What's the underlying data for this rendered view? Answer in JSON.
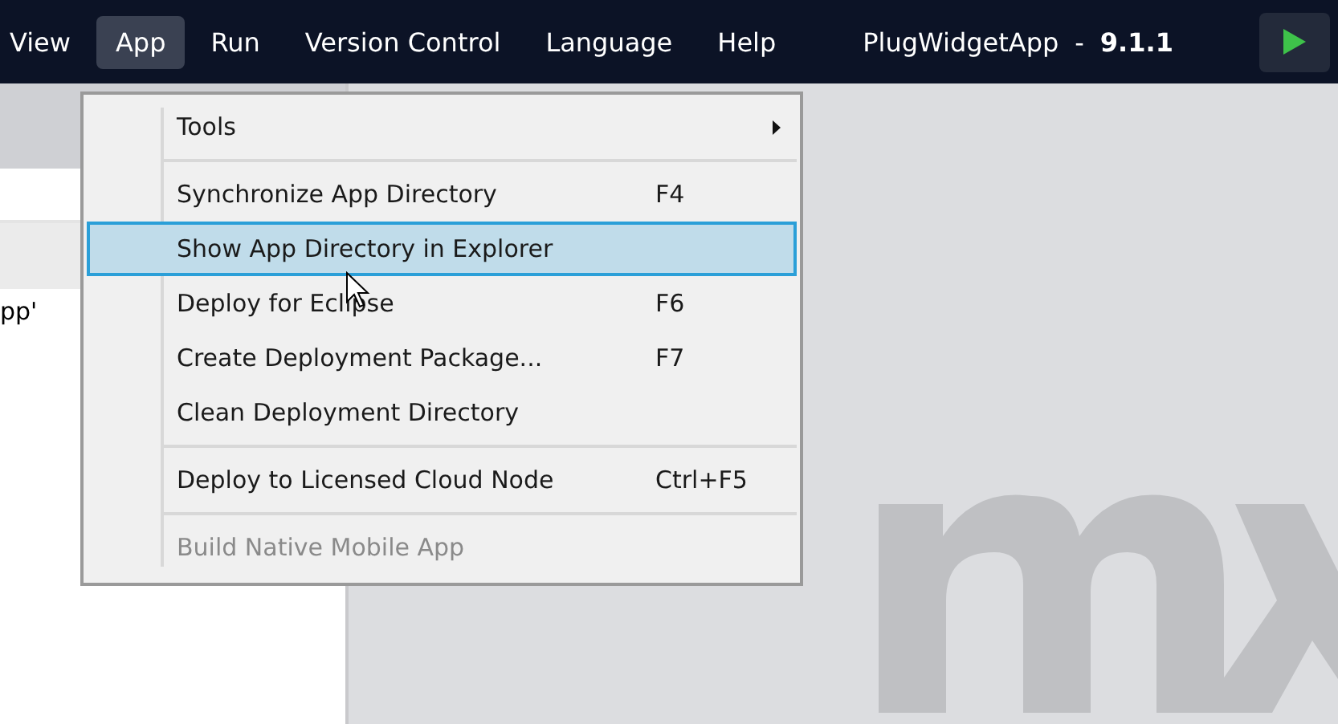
{
  "menubar": {
    "items": [
      {
        "label": "View",
        "selected": false
      },
      {
        "label": "App",
        "selected": true
      },
      {
        "label": "Run",
        "selected": false
      },
      {
        "label": "Version Control",
        "selected": false
      },
      {
        "label": "Language",
        "selected": false
      },
      {
        "label": "Help",
        "selected": false
      }
    ],
    "project_name": "PlugWidgetApp",
    "separator": "-",
    "version": "9.1.1"
  },
  "left_panel": {
    "text": "pp'"
  },
  "menu": {
    "items": [
      {
        "kind": "submenu",
        "label": "Tools",
        "selected": false,
        "disabled": false
      },
      {
        "kind": "separator"
      },
      {
        "kind": "item",
        "label": "Synchronize App Directory",
        "shortcut": "F4",
        "selected": false,
        "disabled": false
      },
      {
        "kind": "item",
        "label": "Show App Directory in Explorer",
        "selected": true,
        "disabled": false
      },
      {
        "kind": "item",
        "label": "Deploy for Eclipse",
        "shortcut": "F6",
        "selected": false,
        "disabled": false
      },
      {
        "kind": "item",
        "label": "Create Deployment Package...",
        "shortcut": "F7",
        "selected": false,
        "disabled": false
      },
      {
        "kind": "item",
        "label": "Clean Deployment Directory",
        "selected": false,
        "disabled": false
      },
      {
        "kind": "separator"
      },
      {
        "kind": "item",
        "label": "Deploy to Licensed Cloud Node",
        "shortcut": "Ctrl+F5",
        "selected": false,
        "disabled": false
      },
      {
        "kind": "separator"
      },
      {
        "kind": "item",
        "label": "Build Native Mobile App",
        "selected": false,
        "disabled": true
      }
    ]
  }
}
